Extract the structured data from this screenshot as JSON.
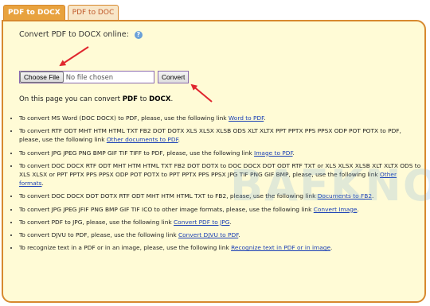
{
  "tabs": [
    {
      "label": "PDF to DOCX",
      "active": true
    },
    {
      "label": "PDF to DOC",
      "active": false
    }
  ],
  "heading": "Convert PDF to DOCX online:",
  "help_icon": "?",
  "file": {
    "choose_label": "Choose File",
    "status": "No file chosen",
    "convert_label": "Convert"
  },
  "intro": {
    "prefix": "On this page you can convert ",
    "from": "PDF",
    "middle": " to ",
    "to": "DOCX",
    "suffix": "."
  },
  "items": [
    {
      "text": "To convert MS Word (DOC DOCX) to PDF, please, use the following link ",
      "link": "Word to PDF",
      "end": "."
    },
    {
      "text": "To convert RTF ODT MHT HTM HTML TXT FB2 DOT DOTX XLS XLSX XLSB ODS XLT XLTX PPT PPTX PPS PPSX ODP POT POTX to PDF, please, use the following link ",
      "link": "Other documents to PDF",
      "end": "."
    },
    {
      "text": "To convert JPG JPEG PNG BMP GIF TIF TIFF to PDF, please, use the following link ",
      "link": "Image to PDF",
      "end": "."
    },
    {
      "text": "To convert DOC DOCX RTF ODT MHT HTM HTML TXT FB2 DOT DOTX to DOC DOCX DOT ODT RTF TXT or XLS XLSX XLSB XLT XLTX ODS to XLS XLSX or PPT PPTX PPS PPSX ODP POT POTX to PPT PPTX PPS PPSX JPG TIF PNG GIF BMP, please, use the following link ",
      "link": "Other formats",
      "end": "."
    },
    {
      "text": "To convert DOC DOCX DOT DOTX RTF ODT MHT HTM HTML TXT to FB2, please, use the following link ",
      "link": "Documents to FB2",
      "end": "."
    },
    {
      "text": "To convert JPG JPEG JFIF PNG BMP GIF TIF ICO to other image formats, please, use the following link ",
      "link": "Convert Image",
      "end": "."
    },
    {
      "text": "To convert PDF to JPG, please, use the following link ",
      "link": "Convert PDF to JPG",
      "end": "."
    },
    {
      "text": "To convert DJVU to PDF, please, use the following link ",
      "link": "Convert DJVU to PDF",
      "end": "."
    },
    {
      "text": "To recognize text in a PDF or in an image, please, use the following link ",
      "link": "Recognize text in PDF or in image",
      "end": "."
    }
  ],
  "watermark": "BAEKNO",
  "colors": {
    "accent": "#e8a23e",
    "panel": "#fffbd6",
    "link": "#1a3fb5",
    "arrow": "#e0272f"
  }
}
